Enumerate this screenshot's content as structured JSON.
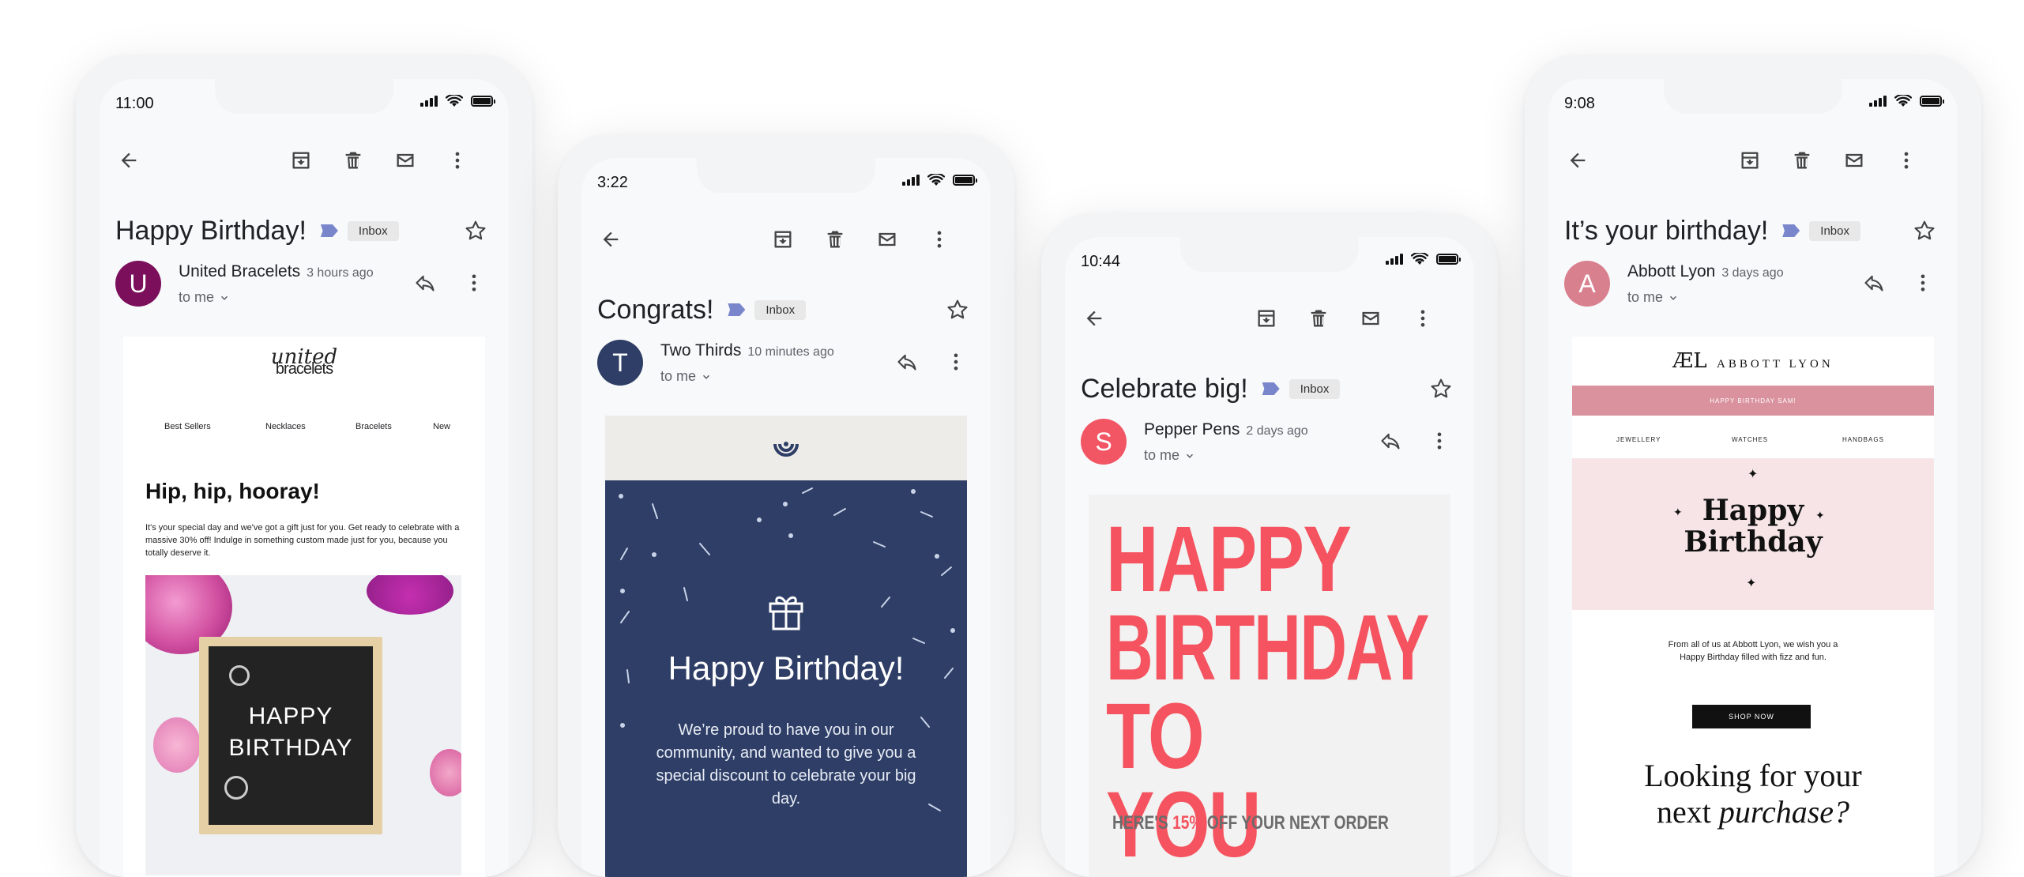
{
  "phones": [
    {
      "time": "11:00",
      "subject": "Happy Birthday!",
      "label": "Inbox",
      "sender": {
        "initial": "U",
        "name": "United Bracelets",
        "time": "3 hours ago",
        "to": "to me",
        "avatar_color": "#7b0f5c"
      },
      "email": {
        "logo_script": "united",
        "logo_word": "bracelets",
        "nav": [
          "Best Sellers",
          "Necklaces",
          "Bracelets",
          "New"
        ],
        "heading": "Hip, hip, hooray!",
        "body": "It's your special day and we've got a gift just for you. Get ready to celebrate with a massive 30% off! Indulge in something custom made just for you, because you totally deserve it.",
        "board_line1": "HAPPY",
        "board_line2": "BIRTHDAY"
      }
    },
    {
      "time": "3:22",
      "subject": "Congrats!",
      "label": "Inbox",
      "sender": {
        "initial": "T",
        "name": "Two Thirds",
        "time": "10 minutes ago",
        "to": "to me",
        "avatar_color": "#2e3e66"
      },
      "email": {
        "heading": "Happy Birthday!",
        "body": "We’re proud to have you in our community, and wanted to give you a special discount to celebrate your big day.",
        "bg_color": "#2e3e66"
      }
    },
    {
      "time": "10:44",
      "subject": "Celebrate big!",
      "label": "Inbox",
      "sender": {
        "initial": "S",
        "name": "Pepper Pens",
        "time": "2 days ago",
        "to": "to me",
        "avatar_color": "#f25563"
      },
      "email": {
        "line1": "HAPPY",
        "line2": "BIRTHDAY",
        "line3": "TO YOU",
        "offer_prefix": "HERE'S",
        "offer_highlight": "15%",
        "offer_suffix": "OFF YOUR NEXT ORDER",
        "accent": "#f4535f"
      }
    },
    {
      "time": "9:08",
      "subject": "It’s your birthday!",
      "label": "Inbox",
      "sender": {
        "initial": "A",
        "name": "Abbott Lyon",
        "time": "3 days ago",
        "to": "to me",
        "avatar_color": "#d9808f"
      },
      "email": {
        "logo_mark": "ÆL",
        "logo_word": "ABBOTT LYON",
        "banner": "HAPPY BIRTHDAY SAM!",
        "nav": [
          "JEWELLERY",
          "WATCHES",
          "HANDBAGS"
        ],
        "hero_line1": "Happy",
        "hero_line2": "Birthday",
        "body": "From all of us at Abbott Lyon, we wish you a Happy Birthday filled with fizz and fun.",
        "cta": "SHOP NOW",
        "footer_line1": "Looking for your",
        "footer_line2_plain": "next",
        "footer_line2_italic": "purchase?"
      }
    }
  ]
}
